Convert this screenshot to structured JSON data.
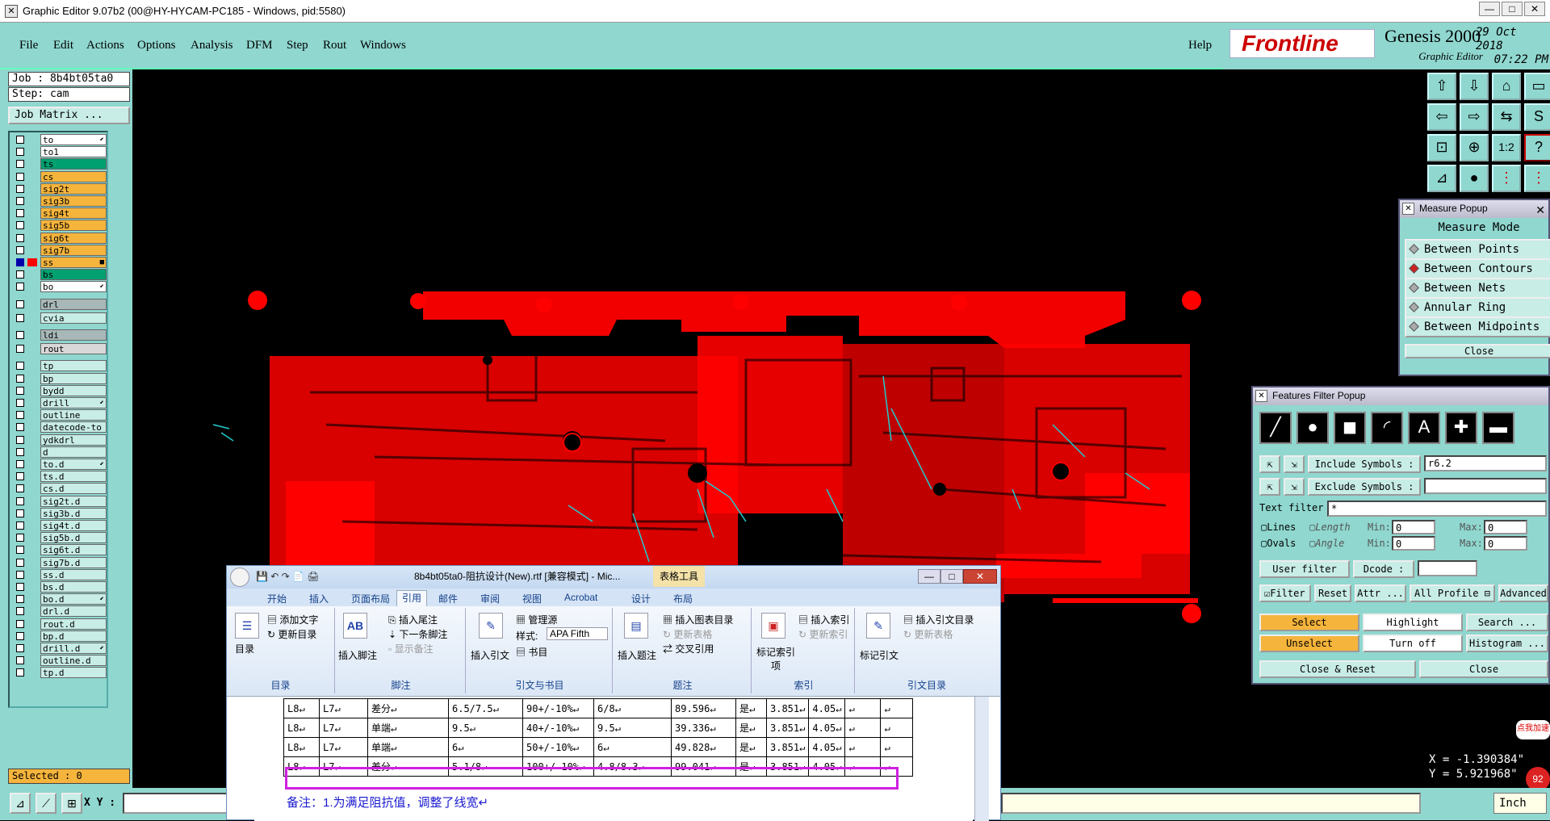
{
  "window": {
    "title": "Graphic Editor 9.07b2 (00@HY-HYCAM-PC185 - Windows, pid:5580)"
  },
  "menu": [
    "File",
    "Edit",
    "Actions",
    "Options",
    "Analysis",
    "DFM",
    "Step",
    "Rout",
    "Windows"
  ],
  "help_label": "Help",
  "brand": {
    "logo": "Frontline",
    "product": "Genesis 2000",
    "subtitle": "Graphic Editor",
    "date": "29 Oct 2018",
    "time": "07:22 PM"
  },
  "job": {
    "job_label": "Job : 8b4bt05ta0",
    "step_label": "Step: cam",
    "matrix_label": "Job Matrix ..."
  },
  "layers": [
    {
      "name": "to",
      "color": "#ffffff",
      "mark": "⬋"
    },
    {
      "name": "to1",
      "color": "#ffffff",
      "mark": ""
    },
    {
      "name": "ts",
      "color": "#00a070",
      "mark": ""
    },
    {
      "name": "cs",
      "color": "#f5b43c",
      "mark": ""
    },
    {
      "name": "sig2t",
      "color": "#f5b43c",
      "mark": ""
    },
    {
      "name": "sig3b",
      "color": "#f5b43c",
      "mark": ""
    },
    {
      "name": "sig4t",
      "color": "#f5b43c",
      "mark": ""
    },
    {
      "name": "sig5b",
      "color": "#f5b43c",
      "mark": ""
    },
    {
      "name": "sig6t",
      "color": "#f5b43c",
      "mark": ""
    },
    {
      "name": "sig7b",
      "color": "#f5b43c",
      "mark": ""
    },
    {
      "name": "ss",
      "color": "#f5b43c",
      "mark": "■",
      "active": true
    },
    {
      "name": "bs",
      "color": "#00a070",
      "mark": ""
    },
    {
      "name": "bo",
      "color": "#ffffff",
      "mark": "⬋"
    },
    {
      "name": "drl",
      "color": "#a8b8b8",
      "mark": ""
    },
    {
      "name": "cvia",
      "color": "#c8ece6",
      "mark": ""
    },
    {
      "name": "ldi",
      "color": "#a8b8b8",
      "mark": ""
    },
    {
      "name": "rout",
      "color": "#d8d8d8",
      "mark": ""
    },
    {
      "name": "tp",
      "color": "#c8ece6",
      "mark": ""
    },
    {
      "name": "bp",
      "color": "#c8ece6",
      "mark": ""
    },
    {
      "name": "bydd",
      "color": "#c8ece6",
      "mark": ""
    },
    {
      "name": "drill",
      "color": "#c8ece6",
      "mark": "⬋"
    },
    {
      "name": "outline",
      "color": "#c8ece6",
      "mark": ""
    },
    {
      "name": "datecode-to",
      "color": "#c8ece6",
      "mark": ""
    },
    {
      "name": "ydkdrl",
      "color": "#c8ece6",
      "mark": ""
    },
    {
      "name": "d",
      "color": "#c8ece6",
      "mark": ""
    },
    {
      "name": "to.d",
      "color": "#c8ece6",
      "mark": "⬋"
    },
    {
      "name": "ts.d",
      "color": "#c8ece6",
      "mark": ""
    },
    {
      "name": "cs.d",
      "color": "#c8ece6",
      "mark": ""
    },
    {
      "name": "sig2t.d",
      "color": "#c8ece6",
      "mark": ""
    },
    {
      "name": "sig3b.d",
      "color": "#c8ece6",
      "mark": ""
    },
    {
      "name": "sig4t.d",
      "color": "#c8ece6",
      "mark": ""
    },
    {
      "name": "sig5b.d",
      "color": "#c8ece6",
      "mark": ""
    },
    {
      "name": "sig6t.d",
      "color": "#c8ece6",
      "mark": ""
    },
    {
      "name": "sig7b.d",
      "color": "#c8ece6",
      "mark": ""
    },
    {
      "name": "ss.d",
      "color": "#c8ece6",
      "mark": ""
    },
    {
      "name": "bs.d",
      "color": "#c8ece6",
      "mark": ""
    },
    {
      "name": "bo.d",
      "color": "#c8ece6",
      "mark": "⬋"
    },
    {
      "name": "drl.d",
      "color": "#c8ece6",
      "mark": ""
    },
    {
      "name": "rout.d",
      "color": "#c8ece6",
      "mark": ""
    },
    {
      "name": "bp.d",
      "color": "#c8ece6",
      "mark": ""
    },
    {
      "name": "drill.d",
      "color": "#c8ece6",
      "mark": "⬋"
    },
    {
      "name": "outline.d",
      "color": "#c8ece6",
      "mark": ""
    },
    {
      "name": "tp.d",
      "color": "#c8ece6",
      "mark": ""
    }
  ],
  "selected_label": "Selected : 0",
  "xy_label": "X Y :",
  "units": "Inch",
  "coords": {
    "x": "X = -1.390384\"",
    "y": "Y = 5.921968\""
  },
  "badge": {
    "text": "点我加速",
    "num": "92"
  },
  "measure": {
    "title": "Measure Popup",
    "header": "Measure Mode",
    "options": [
      {
        "label": "Between Points",
        "selected": false
      },
      {
        "label": "Between Contours",
        "selected": true
      },
      {
        "label": "Between Nets",
        "selected": false
      },
      {
        "label": "Annular Ring",
        "selected": false
      },
      {
        "label": "Between Midpoints",
        "selected": false
      }
    ],
    "close_label": "Close"
  },
  "filter": {
    "title": "Features Filter Popup",
    "include_label": "Include Symbols :",
    "include_value": "r6.2",
    "exclude_label": "Exclude Symbols :",
    "exclude_value": "",
    "text_filter_label": "Text filter",
    "text_filter_value": "*",
    "lines_label": "Lines",
    "ovals_label": "Ovals",
    "length_label": "Length",
    "angle_label": "Angle",
    "min_label": "Min:",
    "max_label": "Max:",
    "len_min": "0",
    "len_max": "0",
    "ang_min": "0",
    "ang_max": "0",
    "user_filter_label": "User filter ...",
    "dcode_label": "Dcode :",
    "filter_label": "Filter",
    "reset_label": "Reset",
    "attr_label": "Attr ...",
    "profile_label": "All Profile",
    "advanced_label": "Advanced",
    "select_label": "Select",
    "highlight_label": "Highlight",
    "search_label": "Search ...",
    "unselect_label": "Unselect",
    "turnoff_label": "Turn off",
    "histogram_label": "Histogram ...",
    "close_reset_label": "Close & Reset",
    "close_label": "Close"
  },
  "word": {
    "title": "8b4bt05ta0-阻抗设计(New).rtf [兼容模式] - Mic...",
    "tools_label": "表格工具",
    "tabs": [
      "开始",
      "插入",
      "页面布局",
      "引用",
      "邮件",
      "审阅",
      "视图",
      "Acrobat",
      "设计",
      "布局"
    ],
    "active_tab": 3,
    "ribbon": {
      "toc_btn": "目录",
      "add_text": "添加文字",
      "update_toc": "更新目录",
      "g_toc": "目录",
      "insert_footnote": "插入脚注",
      "insert_endnote": "插入尾注",
      "next_footnote": "下一条脚注",
      "show_notes": "显示备注",
      "g_footnote": "脚注",
      "insert_citation": "插入引文",
      "manage_sources": "管理源",
      "style_label": "样式:",
      "style_value": "APA Fifth",
      "bibliography": "书目",
      "g_citation": "引文与书目",
      "insert_caption": "插入题注",
      "insert_tof": "插入图表目录",
      "update_table": "更新表格",
      "cross_ref": "交叉引用",
      "g_caption": "题注",
      "mark_entry": "标记索引项",
      "insert_index": "插入索引",
      "update_index": "更新索引",
      "g_index": "索引",
      "mark_citation": "标记引文",
      "insert_toa": "插入引文目录",
      "update_toa": "更新表格",
      "g_toa": "引文目录"
    },
    "rows": [
      [
        "L8↵",
        "L7↵",
        "差分↵",
        "6.5/7.5↵",
        "90+/-10%↵",
        "6/8↵",
        "89.596↵",
        "是↵",
        "3.851↵",
        "4.05↵",
        "↵",
        "↵"
      ],
      [
        "L8↵",
        "L7↵",
        "单端↵",
        "9.5↵",
        "40+/-10%↵",
        "9.5↵",
        "39.336↵",
        "是↵",
        "3.851↵",
        "4.05↵",
        "↵",
        "↵"
      ],
      [
        "L8↵",
        "L7↵",
        "单端↵",
        "6↵",
        "50+/-10%↵",
        "6↵",
        "49.828↵",
        "是↵",
        "3.851↵",
        "4.05↵",
        "↵",
        "↵"
      ],
      [
        "L8↵",
        "L7↵",
        "差分↵",
        "5.1/8↵",
        "100+/-10%↵",
        "4.8/8.3↵",
        "99.041↵",
        "是↵",
        "3.851↵",
        "4.05↵",
        "↵",
        "↵"
      ]
    ],
    "note": "备注：1.为满足阻抗值，调整了线宽↵"
  }
}
